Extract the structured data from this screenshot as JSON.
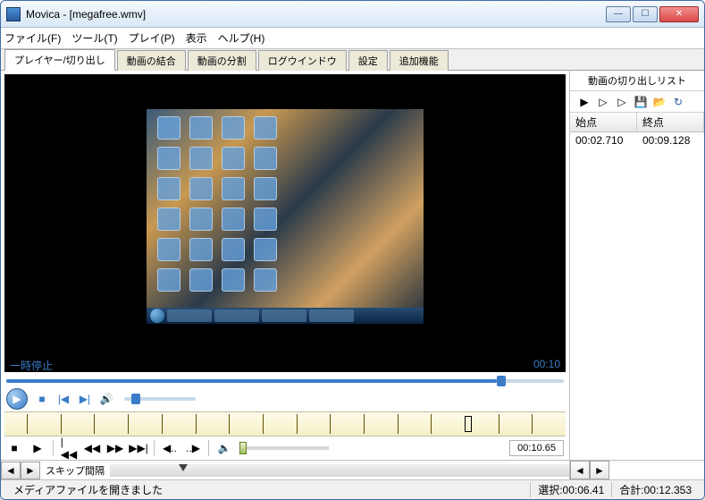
{
  "title": "Movica - [megafree.wmv]",
  "menu": {
    "file": "ファイル(F)",
    "tools": "ツール(T)",
    "play": "プレイ(P)",
    "view": "表示",
    "help": "ヘルプ(H)"
  },
  "tabs": {
    "player": "プレイヤー/切り出し",
    "join": "動画の結合",
    "split": "動画の分割",
    "log": "ログウインドウ",
    "settings": "設定",
    "extra": "追加機能"
  },
  "right": {
    "title": "動画の切り出しリスト",
    "header_start": "始点",
    "header_end": "終点",
    "rows": [
      {
        "start": "00:02.710",
        "end": "00:09.128"
      }
    ]
  },
  "video_status": {
    "left": "一時停止",
    "right": "00:10"
  },
  "edit_time": "00:10.65",
  "skip_label": "スキップ間隔",
  "status": {
    "message": "メディアファイルを開きました",
    "selection_label": "選択:",
    "selection": "00:06.41",
    "total_label": "合計:",
    "total": "00:12.353"
  },
  "icons": {
    "play": "▶",
    "play_outline": "▷",
    "play_edit": "▷",
    "save": "💾",
    "folder": "📂",
    "refresh": "↻",
    "stop": "■",
    "prev": "|◀",
    "next": "▶|",
    "volume": "🔊",
    "rec_stop": "■",
    "rec_play": "▶",
    "skip_first": "|◀◀",
    "skip_bwd": "◀◀",
    "skip_fwd": "▶▶",
    "skip_last": "▶▶|",
    "nudge_bwd": "◀..",
    "nudge_fwd": "..▶",
    "sep": "|",
    "speaker": "🔈",
    "arrow_left": "◄",
    "arrow_right": "►"
  }
}
